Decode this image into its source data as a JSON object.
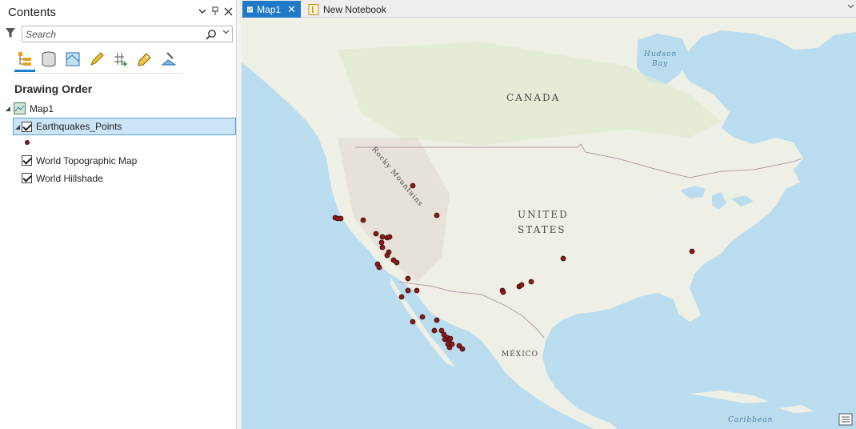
{
  "contents_pane": {
    "title": "Contents",
    "controls": {
      "options": "⌄",
      "pin": "📌",
      "close": "✕"
    },
    "search": {
      "placeholder": "Search"
    },
    "section_title": "Drawing Order",
    "view_tabs": [
      "list-by-drawing-order",
      "list-by-source",
      "list-by-selection",
      "list-by-editing",
      "list-by-snapping",
      "list-by-labeling",
      "list-by-perspective-imagery"
    ]
  },
  "layers": {
    "map": "Map1",
    "items": [
      {
        "label": "Earthquakes_Points",
        "checked": true,
        "selected": true
      },
      {
        "label": "World Topographic Map",
        "checked": true
      },
      {
        "label": "World Hillshade",
        "checked": true
      }
    ]
  },
  "tabs": {
    "map_tab": "Map1",
    "notebook_tab": "New Notebook"
  },
  "map": {
    "labels": {
      "canada": "CANADA",
      "us_line1": "UNITED",
      "us_line2": "STATES",
      "mexico": "MÉXICO",
      "rocky": "Rocky Mountains",
      "hudson1": "Hudson",
      "hudson2": "Bay",
      "caribbean": "Caribbean"
    },
    "colors": {
      "point_fill": "#8b1a1a",
      "land": "#eef0e6",
      "water": "#b9dcef",
      "accent": "#1f78c8"
    }
  }
}
